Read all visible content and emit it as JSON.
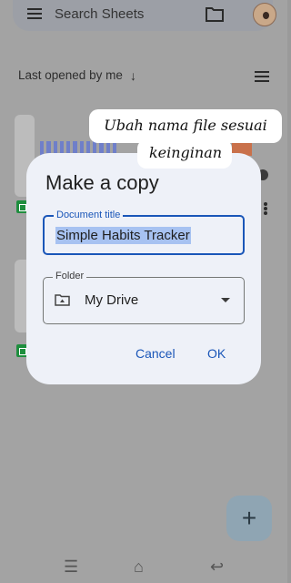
{
  "background": {
    "search_placeholder": "Search Sheets",
    "sort_label": "Last opened by me",
    "sort_direction_symbol": "↓",
    "fab_symbol": "+"
  },
  "dialog": {
    "title": "Make a copy",
    "document_title_label": "Document title",
    "document_title_value": "Simple Habits Tracker",
    "folder_label": "Folder",
    "folder_value": "My Drive",
    "cancel_label": "Cancel",
    "ok_label": "OK"
  },
  "annotation": {
    "line1": "Ubah nama file sesuai",
    "line2": "keinginan"
  },
  "navbar": {
    "recents_symbol": "☰",
    "home_symbol": "⌂",
    "back_symbol": "↩"
  },
  "colors": {
    "accent": "#1a56b8",
    "selection": "#a7c2f1",
    "dialog_bg": "#eef1f8",
    "sheets_green": "#1e8e3e"
  },
  "icons": [
    "menu-icon",
    "folder-icon",
    "list-view-icon",
    "more-vert-icon",
    "drive-folder-icon",
    "dropdown-arrow-icon",
    "add-icon",
    "sheets-icon"
  ]
}
